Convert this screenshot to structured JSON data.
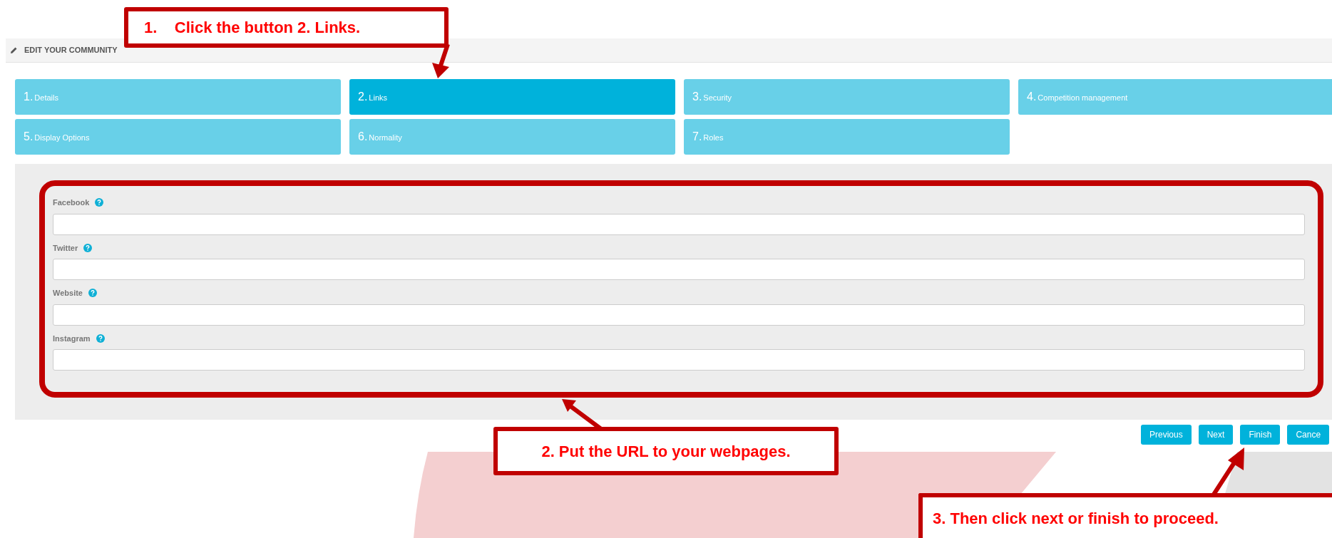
{
  "header": {
    "title": "EDIT YOUR COMMUNITY"
  },
  "tabs": [
    {
      "number": "1.",
      "label": "Details",
      "selected": false
    },
    {
      "number": "2.",
      "label": "Links",
      "selected": true
    },
    {
      "number": "3.",
      "label": "Security",
      "selected": false
    },
    {
      "number": "4.",
      "label": "Competition management",
      "selected": false
    },
    {
      "number": "5.",
      "label": "Display Options",
      "selected": false
    },
    {
      "number": "6.",
      "label": "Normality",
      "selected": false
    },
    {
      "number": "7.",
      "label": "Roles",
      "selected": false
    }
  ],
  "fields": [
    {
      "label": "Facebook"
    },
    {
      "label": "Twitter"
    },
    {
      "label": "Website"
    },
    {
      "label": "Instagram"
    }
  ],
  "buttons": [
    "Previous",
    "Next",
    "Finish",
    "Cance"
  ],
  "annotations": [
    {
      "text": "1.    Click the button 2. Links."
    },
    {
      "text": "2. Put the URL to your webpages."
    },
    {
      "text": "3. Then click next or finish to proceed."
    }
  ]
}
